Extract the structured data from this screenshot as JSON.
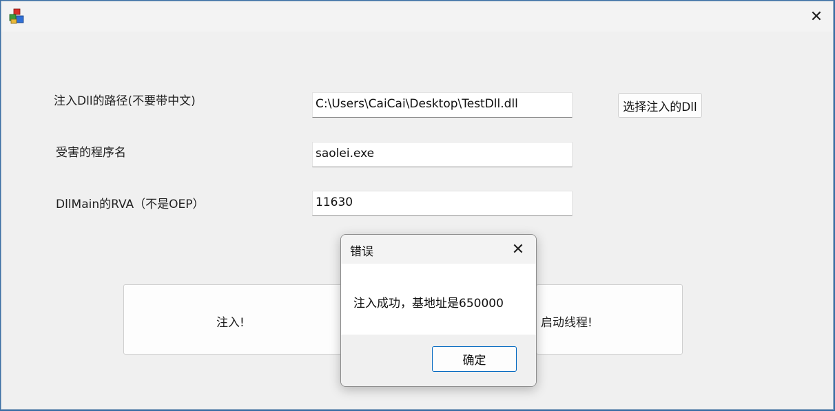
{
  "window": {
    "close_glyph": "✕",
    "app_icon": "app-cubes-icon"
  },
  "form": {
    "dll_path_label": "注入Dll的路径(不要带中文)",
    "dll_path_value": "C:\\Users\\CaiCai\\Desktop\\TestDll.dll",
    "select_dll_button": "选择注入的Dll",
    "process_label": "受害的程序名",
    "process_value": "saolei.exe",
    "rva_label": "DllMain的RVA（不是OEP）",
    "rva_value": "11630"
  },
  "buttons": {
    "inject": "注入!",
    "start_thread": "启动线程!"
  },
  "dialog": {
    "title": "错误",
    "close_glyph": "✕",
    "message": "注入成功，基地址是650000",
    "ok": "确定"
  },
  "colors": {
    "desktop": "#3a6ea5",
    "window_bg": "#f0f0f0",
    "accent": "#0067c0"
  }
}
